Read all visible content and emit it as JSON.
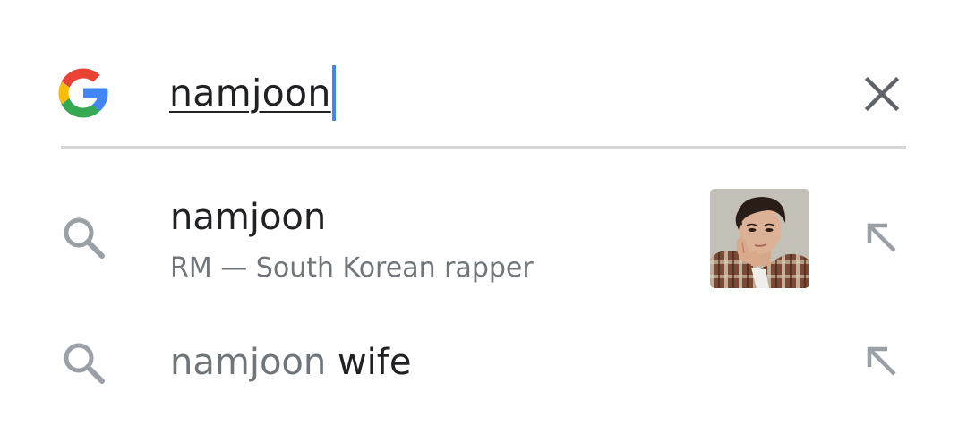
{
  "search_bar": {
    "query": "namjoon",
    "logo_icon": "google-g-icon",
    "clear_icon": "close-icon"
  },
  "suggestions": [
    {
      "title": "namjoon",
      "subtitle": "RM — South Korean rapper",
      "leading_icon": "search-icon",
      "has_thumbnail": true,
      "trailing_icon": "arrow-up-left-icon"
    },
    {
      "matched": "namjoon",
      "completion": " wife",
      "leading_icon": "search-icon",
      "trailing_icon": "arrow-up-left-icon"
    }
  ],
  "colors": {
    "caret": "#4285f4",
    "text_primary": "#202124",
    "text_secondary": "#70757a",
    "icon_gray": "#9aa0a6",
    "divider": "#d6d6d6",
    "google_blue": "#4285f4",
    "google_red": "#ea4335",
    "google_yellow": "#fbbc05",
    "google_green": "#34a853"
  }
}
